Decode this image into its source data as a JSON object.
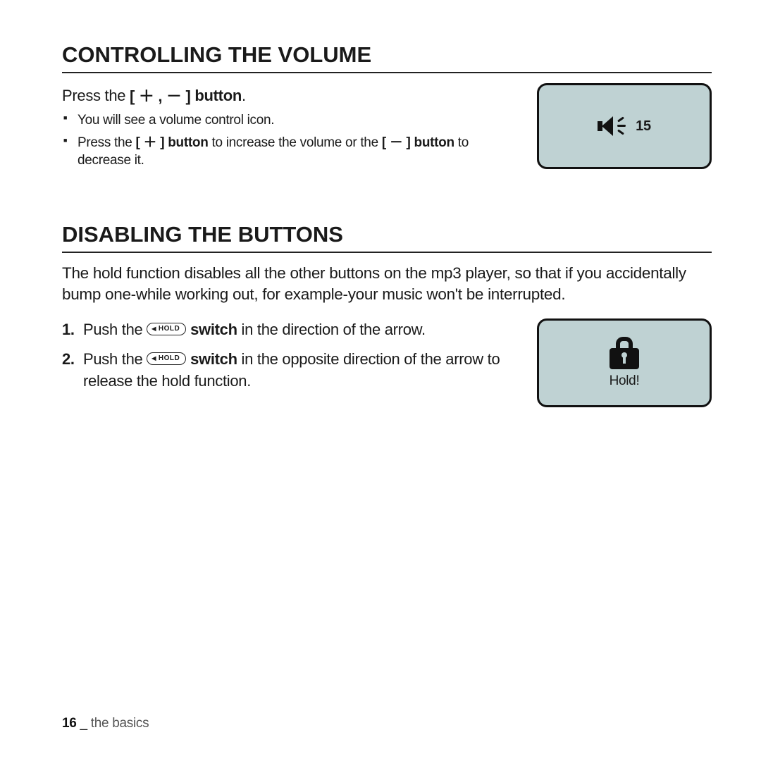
{
  "section1": {
    "title": "CONTROLLING THE VOLUME",
    "subhead_pre": "Press the ",
    "subhead_glyph": "[ ＋ , － ]",
    "subhead_post": " button",
    "bullets": {
      "b1": "You will see a volume control icon.",
      "b2_pre": "Press the ",
      "b2_btn1": "[ ＋ ] button",
      "b2_mid": " to increase the volume or the ",
      "b2_btn2": "[ － ] button",
      "b2_post": " to decrease it."
    },
    "volume_value": "15"
  },
  "section2": {
    "title": "DISABLING THE BUTTONS",
    "intro": "The hold function disables all the other buttons on the mp3 player, so that if you accidentally bump one-while working out, for example-your music won't be interrupted.",
    "hold_switch_label": "HOLD",
    "steps": {
      "s1_num": "1.",
      "s1_pre": "Push the ",
      "s1_bold": " switch",
      "s1_post": " in the direction of the arrow.",
      "s2_num": "2.",
      "s2_pre": "Push the ",
      "s2_bold": " switch",
      "s2_post": " in the opposite direction of the arrow to release the hold function."
    },
    "hold_caption": "Hold!"
  },
  "footer": {
    "page_number": "16",
    "separator": " _ ",
    "chapter": "the basics"
  }
}
